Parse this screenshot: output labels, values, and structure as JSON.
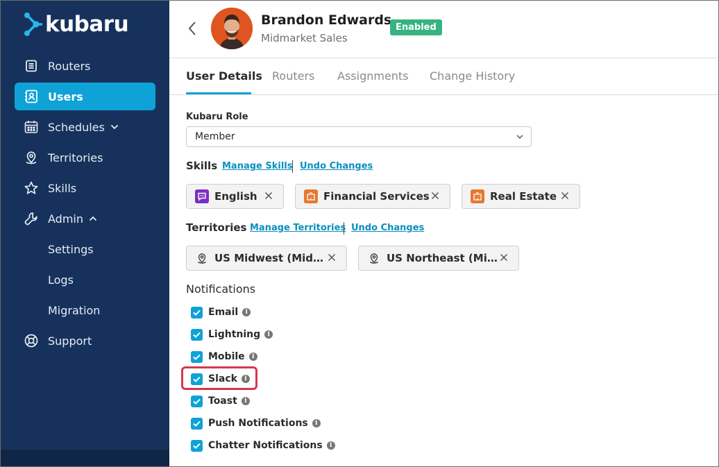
{
  "app": {
    "name": "kubaru"
  },
  "sidebar": {
    "items": [
      {
        "label": "Routers"
      },
      {
        "label": "Users"
      },
      {
        "label": "Schedules"
      },
      {
        "label": "Territories"
      },
      {
        "label": "Skills"
      },
      {
        "label": "Admin"
      },
      {
        "label": "Settings"
      },
      {
        "label": "Logs"
      },
      {
        "label": "Migration"
      },
      {
        "label": "Support"
      }
    ]
  },
  "header": {
    "name": "Brandon Edwards",
    "subtitle": "Midmarket Sales",
    "status": "Enabled"
  },
  "tabs": [
    {
      "label": "User Details"
    },
    {
      "label": "Routers"
    },
    {
      "label": "Assignments"
    },
    {
      "label": "Change History"
    }
  ],
  "details": {
    "role_label": "Kubaru Role",
    "role_value": "Member",
    "skills_label": "Skills",
    "manage_skills": "Manage Skills",
    "undo_changes": "Undo Changes",
    "skills": [
      {
        "label": "English",
        "color": "#7b2fbf"
      },
      {
        "label": "Financial Services",
        "color": "#e8772e"
      },
      {
        "label": "Real Estate",
        "color": "#e8772e"
      }
    ],
    "territories_label": "Territories",
    "manage_territories": "Manage Territories",
    "territories": [
      {
        "label": "US Midwest (Mid…"
      },
      {
        "label": "US Northeast (Mi…"
      }
    ],
    "notifications_label": "Notifications",
    "notifications": [
      {
        "label": "Email",
        "checked": true
      },
      {
        "label": "Lightning",
        "checked": true
      },
      {
        "label": "Mobile",
        "checked": true
      },
      {
        "label": "Slack",
        "checked": true
      },
      {
        "label": "Toast",
        "checked": true
      },
      {
        "label": "Push Notifications",
        "checked": true
      },
      {
        "label": "Chatter Notifications",
        "checked": true
      }
    ]
  },
  "colors": {
    "sidebar": "#16325c",
    "accent": "#0ea2d6",
    "badge": "#36b37e",
    "highlight": "#d8364f"
  }
}
